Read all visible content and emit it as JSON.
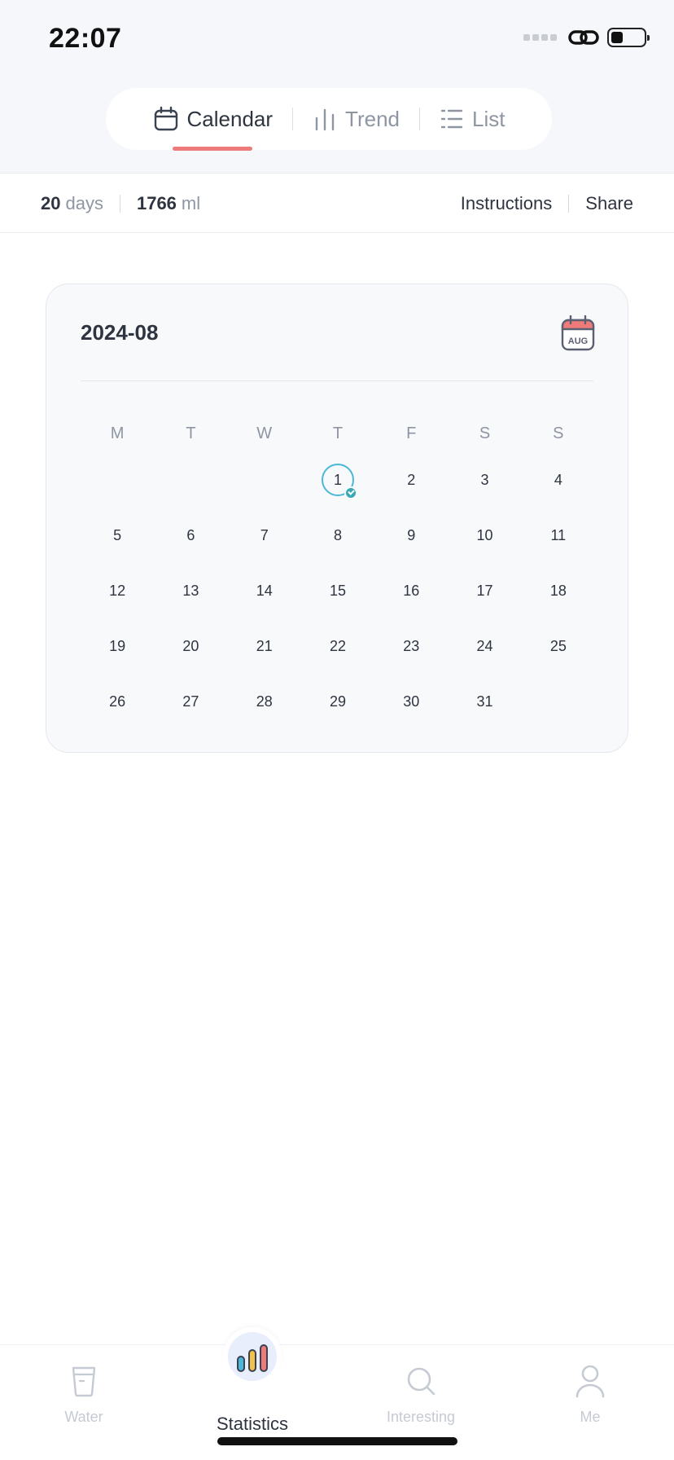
{
  "status": {
    "time": "22:07"
  },
  "tabs": [
    {
      "label": "Calendar",
      "icon": "calendar-icon",
      "active": true
    },
    {
      "label": "Trend",
      "icon": "bar-chart-icon",
      "active": false
    },
    {
      "label": "List",
      "icon": "list-icon",
      "active": false
    }
  ],
  "stats": {
    "days_value": "20",
    "days_unit": "days",
    "volume_value": "1766",
    "volume_unit": "ml",
    "instructions_label": "Instructions",
    "share_label": "Share"
  },
  "calendar": {
    "title": "2024-08",
    "month_badge": "AUG",
    "weekdays": [
      "M",
      "T",
      "W",
      "T",
      "F",
      "S",
      "S"
    ],
    "weeks": [
      [
        "",
        "",
        "",
        "1",
        "2",
        "3",
        "4"
      ],
      [
        "5",
        "6",
        "7",
        "8",
        "9",
        "10",
        "11"
      ],
      [
        "12",
        "13",
        "14",
        "15",
        "16",
        "17",
        "18"
      ],
      [
        "19",
        "20",
        "21",
        "22",
        "23",
        "24",
        "25"
      ],
      [
        "26",
        "27",
        "28",
        "29",
        "30",
        "31",
        ""
      ]
    ],
    "marked_day": "1",
    "ring_color": "#4bb8d8",
    "check_color": "#39aab3"
  },
  "nav": {
    "water_label": "Water",
    "statistics_label": "Statistics",
    "interesting_label": "Interesting",
    "me_label": "Me"
  },
  "colors": {
    "accent": "#ef7a7a",
    "text": "#2e3440",
    "muted": "#8e95a3"
  }
}
